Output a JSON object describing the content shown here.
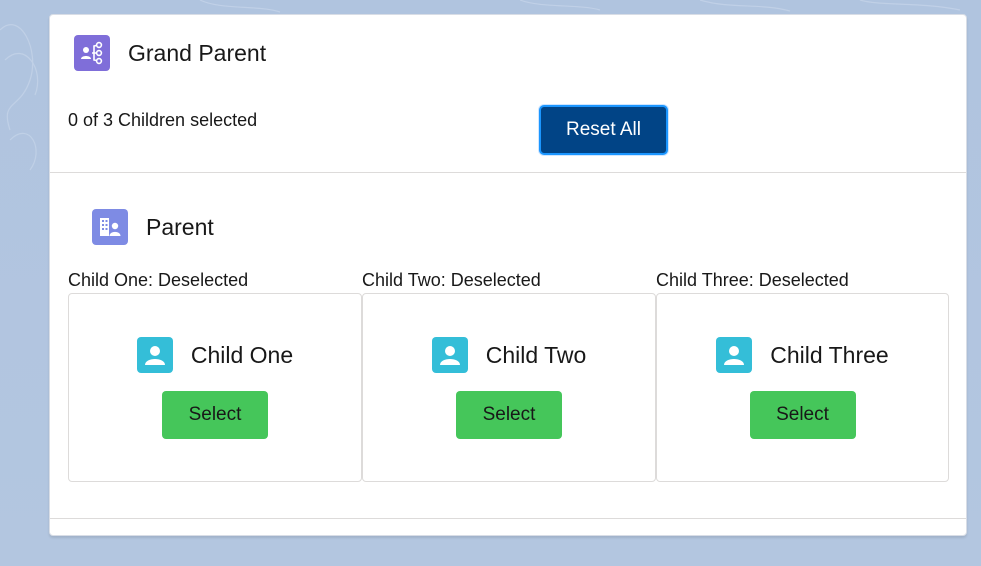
{
  "grand_parent": {
    "title": "Grand Parent",
    "icon": "hierarchy-icon",
    "selected_text": "0 of 3 Children selected",
    "reset_label": "Reset All"
  },
  "parent": {
    "title": "Parent",
    "icon": "building-contact-icon"
  },
  "children": [
    {
      "status": "Child One: Deselected",
      "name": "Child One",
      "select_label": "Select",
      "icon": "user-icon"
    },
    {
      "status": "Child Two: Deselected",
      "name": "Child Two",
      "select_label": "Select",
      "icon": "user-icon"
    },
    {
      "status": "Child Three: Deselected",
      "name": "Child Three",
      "select_label": "Select",
      "icon": "user-icon"
    }
  ],
  "colors": {
    "brand": "#014486",
    "select_green": "#45c65a",
    "gp_icon_bg": "#7f6ed9",
    "parent_icon_bg": "#7e8be4",
    "child_icon_bg": "#34bed8",
    "background": "#b0c4df"
  }
}
